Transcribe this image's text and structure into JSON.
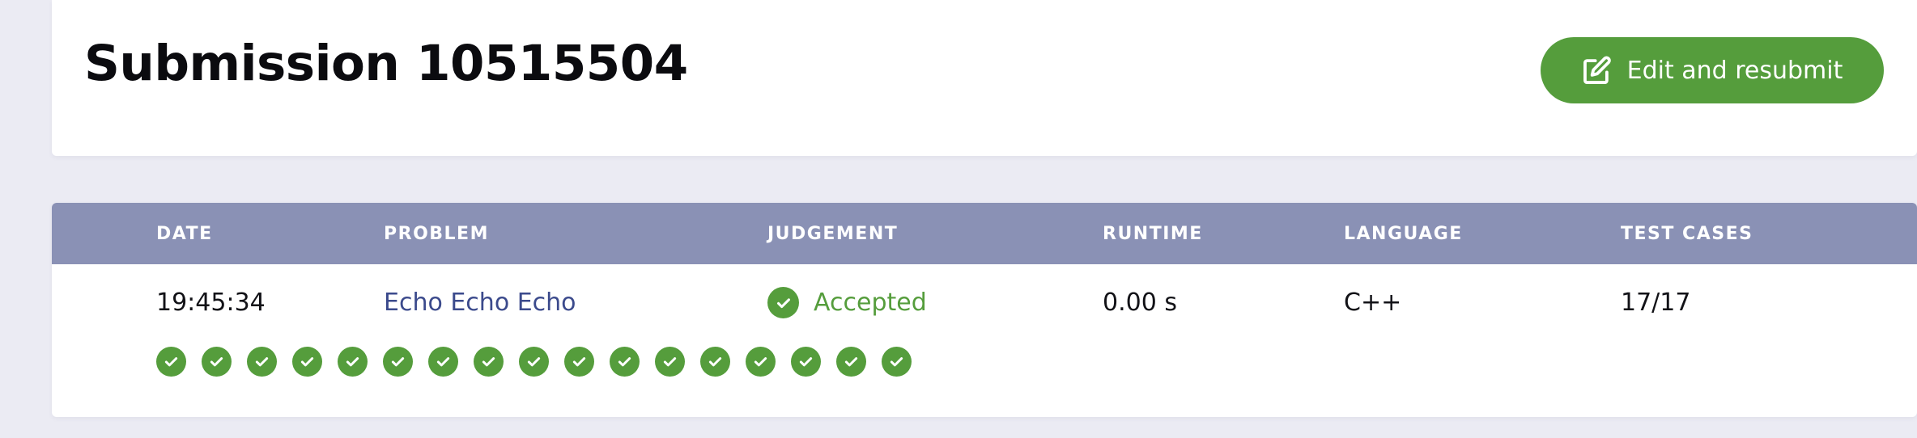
{
  "header": {
    "title": "Submission 10515504",
    "edit_button_label": "Edit and resubmit"
  },
  "table": {
    "columns": {
      "date": "DATE",
      "problem": "PROBLEM",
      "judgement": "JUDGEMENT",
      "runtime": "RUNTIME",
      "language": "LANGUAGE",
      "test_cases": "TEST CASES"
    },
    "row": {
      "date": "19:45:34",
      "problem": "Echo Echo Echo",
      "judgement": "Accepted",
      "runtime": "0.00 s",
      "language": "C++",
      "test_cases": "17/17"
    },
    "test_results": [
      "passed",
      "passed",
      "passed",
      "passed",
      "passed",
      "passed",
      "passed",
      "passed",
      "passed",
      "passed",
      "passed",
      "passed",
      "passed",
      "passed",
      "passed",
      "passed",
      "passed"
    ]
  },
  "icons": {
    "edit": "edit-icon",
    "check": "check-circle-icon"
  },
  "colors": {
    "accent": "#559d3c",
    "table_header": "#8a91b5",
    "link": "#3b4a8c",
    "background": "#ebebf3"
  }
}
